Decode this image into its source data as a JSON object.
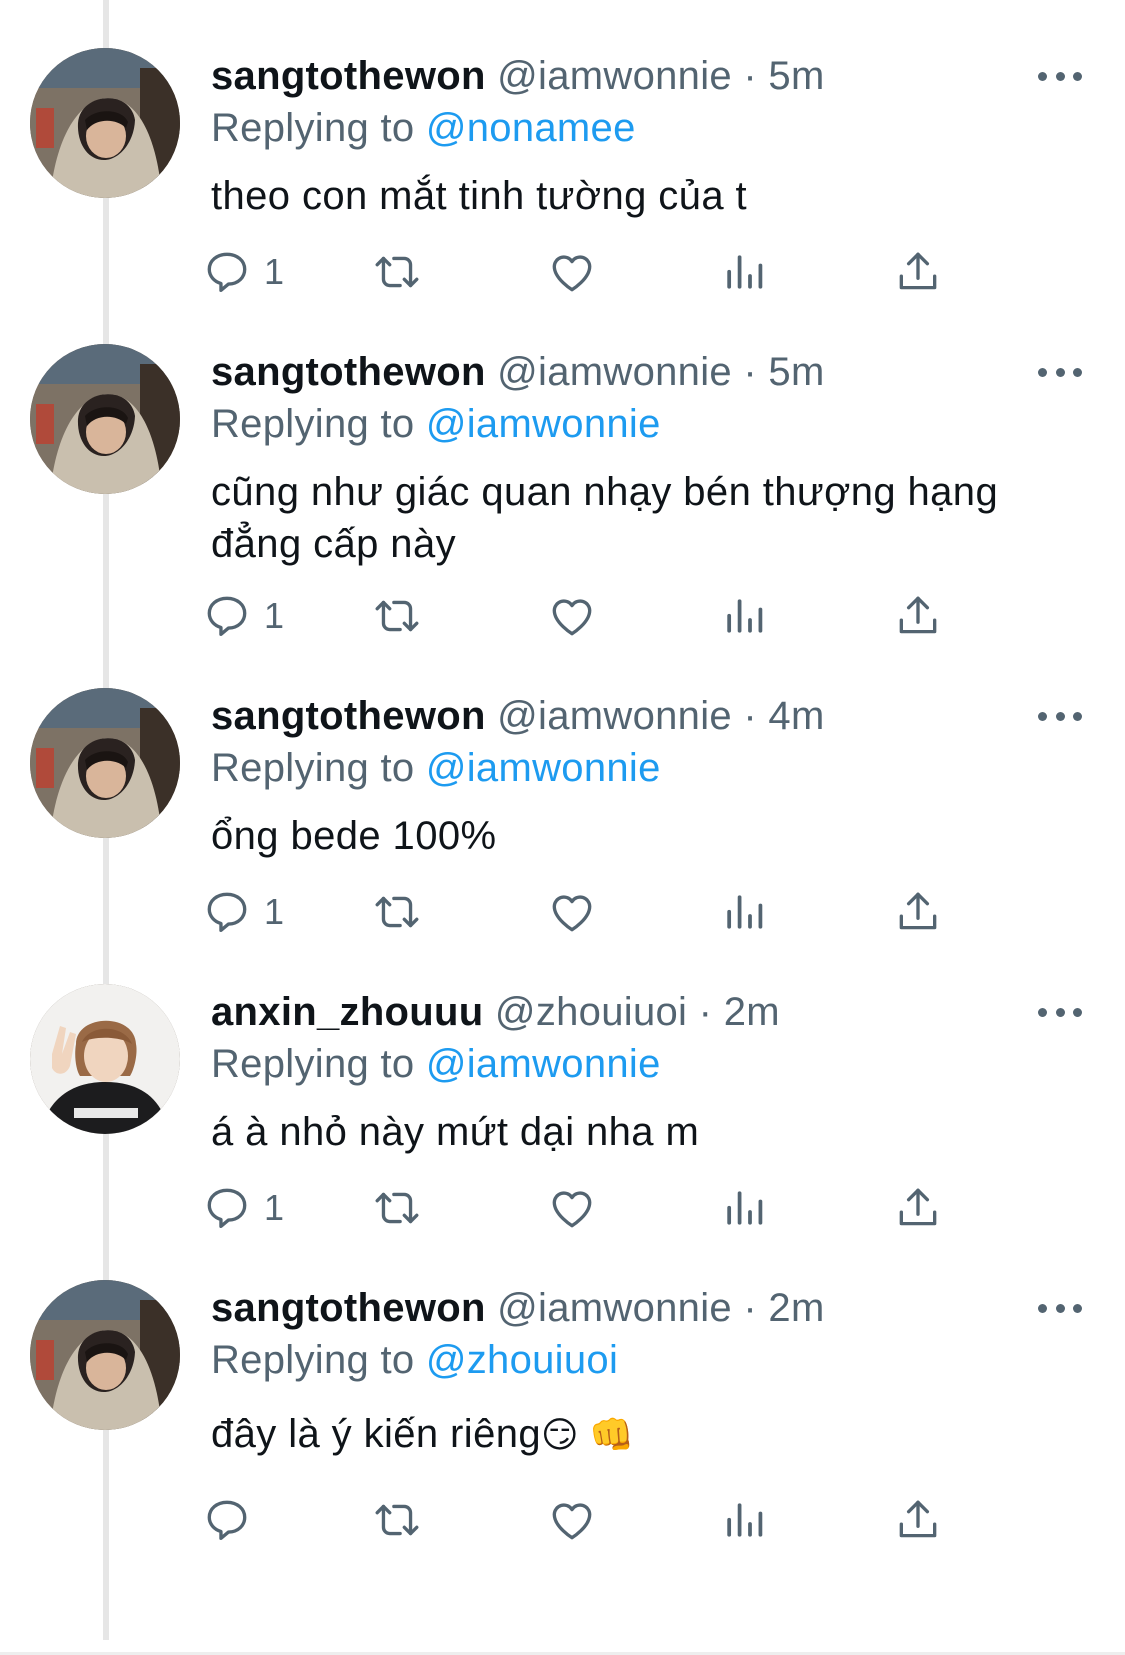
{
  "theme": {
    "accent": "#1d9bf0",
    "muted": "#536471",
    "text": "#0f1419",
    "thread_line": "#e6e6e6"
  },
  "tweets": [
    {
      "display_name": "sangtothewon",
      "handle": "@iamwonnie",
      "separator": "·",
      "time": "5m",
      "replying_label": "Replying to",
      "replying_to": "@nonamee",
      "text": "theo con mắt tinh tường của t",
      "reply_count": "1",
      "avatar": "hooded-person-avatar"
    },
    {
      "display_name": "sangtothewon",
      "handle": "@iamwonnie",
      "separator": "·",
      "time": "5m",
      "replying_label": "Replying to",
      "replying_to": "@iamwonnie",
      "text": "cũng như giác quan nhạy bén thượng hạng đẳng cấp này",
      "reply_count": "1",
      "avatar": "hooded-person-avatar"
    },
    {
      "display_name": "sangtothewon",
      "handle": "@iamwonnie",
      "separator": "·",
      "time": "4m",
      "replying_label": "Replying to",
      "replying_to": "@iamwonnie",
      "text": "ổng bede 100%",
      "reply_count": "1",
      "avatar": "hooded-person-avatar"
    },
    {
      "display_name": "anxin_zhouuu",
      "handle": "@zhouiuoi",
      "separator": "·",
      "time": "2m",
      "replying_label": "Replying to",
      "replying_to": "@iamwonnie",
      "text": "á à nhỏ này mứt dại nha m",
      "reply_count": "1",
      "avatar": "peace-sign-person-avatar"
    },
    {
      "display_name": "sangtothewon",
      "handle": "@iamwonnie",
      "separator": "·",
      "time": "2m",
      "replying_label": "Replying to",
      "replying_to": "@zhouiuoi",
      "text": "đây là ý kiến riêng",
      "emoji": "😏 👊",
      "reply_count": "",
      "avatar": "hooded-person-avatar"
    }
  ],
  "icons": {
    "reply": "reply-icon",
    "retweet": "retweet-icon",
    "like": "heart-icon",
    "views": "views-icon",
    "share": "share-icon",
    "more": "more-icon"
  }
}
